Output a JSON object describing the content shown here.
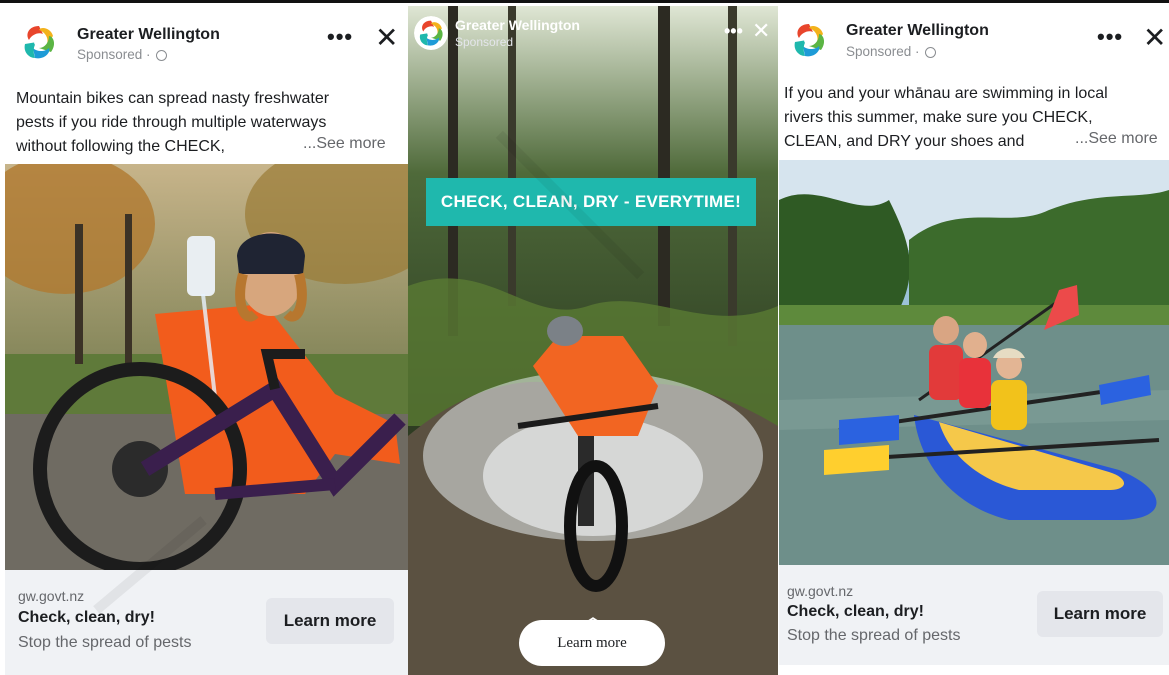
{
  "colors": {
    "facebook_text": "#1c1e21",
    "muted_text": "#65676b",
    "footer_bg": "#f0f2f5",
    "button_bg": "#e4e6eb",
    "banner_teal": "#1fb8ad"
  },
  "ad1": {
    "page_name": "Greater Wellington",
    "sponsored": "Sponsored ·",
    "caption_lines": [
      "Mountain bikes can spread nasty freshwater",
      "pests if you ride through multiple waterways",
      "without following the CHECK,"
    ],
    "see_more": "...See more",
    "domain": "gw.govt.nz",
    "headline": "Check, clean, dry!",
    "description": "Stop the spread of pests",
    "cta": "Learn more",
    "icons": [
      "menu-dots-icon",
      "close-icon",
      "globe-icon"
    ]
  },
  "ad2": {
    "page_name": "Greater Wellington",
    "sponsored": "Sponsored",
    "banner": "CHECK, CLEAN, DRY - EVERYTIME!",
    "cta": "Learn more",
    "icons": [
      "menu-dots-icon",
      "close-icon",
      "chevron-up-icon"
    ]
  },
  "ad3": {
    "page_name": "Greater Wellington",
    "sponsored": "Sponsored ·",
    "caption_lines": [
      "If you and your whānau are swimming in local",
      "rivers this summer, make sure you CHECK,",
      "CLEAN, and DRY your shoes and"
    ],
    "see_more": "...See more",
    "domain": "gw.govt.nz",
    "headline": "Check, clean, dry!",
    "description": "Stop the spread of pests",
    "cta": "Learn more",
    "icons": [
      "menu-dots-icon",
      "close-icon",
      "globe-icon"
    ]
  }
}
